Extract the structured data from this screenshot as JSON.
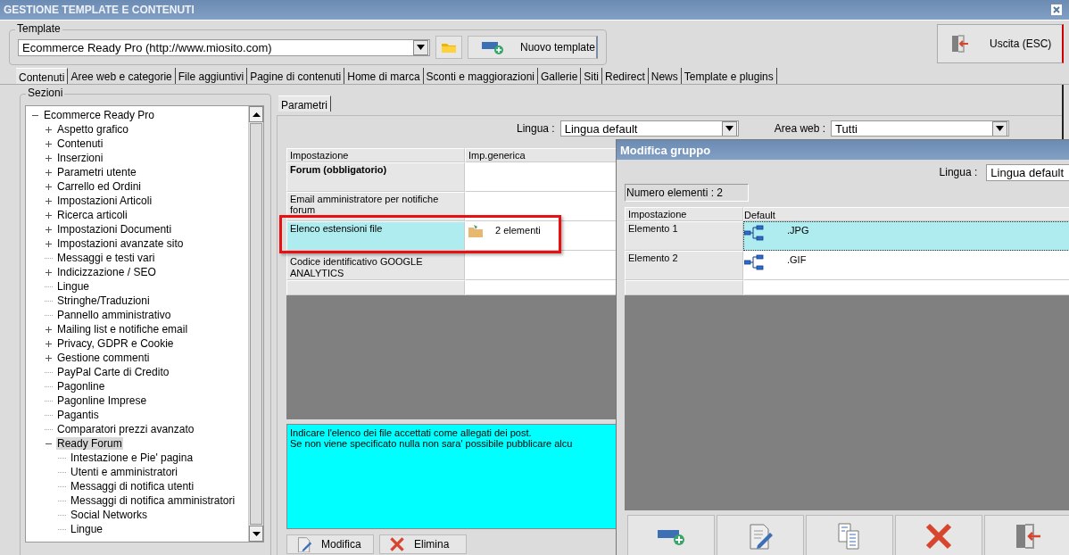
{
  "window": {
    "title": "GESTIONE TEMPLATE E CONTENUTI"
  },
  "template": {
    "legend": "Template",
    "value": "Ecommerce Ready Pro (http://www.miosito.com)",
    "new_button": "Nuovo template",
    "exit_button": "Uscita (ESC)"
  },
  "tabs": [
    {
      "label": "Contenuti",
      "selected": true
    },
    {
      "label": "Aree web e categorie",
      "selected": false
    },
    {
      "label": "File aggiuntivi",
      "selected": false
    },
    {
      "label": "Pagine di contenuti",
      "selected": false
    },
    {
      "label": "Home di marca",
      "selected": false
    },
    {
      "label": "Sconti e maggiorazioni",
      "selected": false
    },
    {
      "label": "Gallerie",
      "selected": false
    },
    {
      "label": "Siti",
      "selected": false
    },
    {
      "label": "Redirect",
      "selected": false
    },
    {
      "label": "News",
      "selected": false
    },
    {
      "label": "Template e plugins",
      "selected": false
    }
  ],
  "sections": {
    "legend": "Sezioni",
    "tree": [
      {
        "label": "Ecommerce Ready Pro",
        "expanded": true,
        "selected": false,
        "children": [
          {
            "label": "Aspetto grafico",
            "expanded": false,
            "selected": false
          },
          {
            "label": "Contenuti",
            "expanded": false,
            "selected": false
          },
          {
            "label": "Inserzioni",
            "expanded": false,
            "selected": false
          },
          {
            "label": "Parametri utente",
            "expanded": false,
            "selected": false
          },
          {
            "label": "Carrello ed Ordini",
            "expanded": false,
            "selected": false
          },
          {
            "label": "Impostazioni Articoli",
            "expanded": false,
            "selected": false
          },
          {
            "label": "Ricerca articoli",
            "expanded": false,
            "selected": false
          },
          {
            "label": "Impostazioni Documenti",
            "expanded": false,
            "selected": false
          },
          {
            "label": "Impostazioni avanzate sito",
            "expanded": false,
            "selected": false
          },
          {
            "label": "Messaggi e testi vari",
            "selected": false
          },
          {
            "label": "Indicizzazione / SEO",
            "expanded": false,
            "selected": false
          },
          {
            "label": "Lingue",
            "selected": false
          },
          {
            "label": "Stringhe/Traduzioni",
            "selected": false
          },
          {
            "label": "Pannello amministrativo",
            "selected": false
          },
          {
            "label": "Mailing list e notifiche email",
            "expanded": false,
            "selected": false
          },
          {
            "label": "Privacy, GDPR e Cookie",
            "expanded": false,
            "selected": false
          },
          {
            "label": "Gestione commenti",
            "expanded": false,
            "selected": false
          },
          {
            "label": "PayPal Carte di Credito",
            "selected": false
          },
          {
            "label": "Pagonline",
            "selected": false
          },
          {
            "label": "Pagonline Imprese",
            "selected": false
          },
          {
            "label": "Pagantis",
            "selected": false
          },
          {
            "label": "Comparatori prezzi avanzato",
            "selected": false
          },
          {
            "label": "Ready Forum",
            "expanded": true,
            "selected": true,
            "children": [
              {
                "label": "Intestazione e Pie' pagina",
                "selected": false
              },
              {
                "label": "Utenti e amministratori",
                "selected": false
              },
              {
                "label": "Messaggi di notifica utenti",
                "selected": false
              },
              {
                "label": "Messaggi di notifica amministratori",
                "selected": false
              },
              {
                "label": "Social Networks",
                "selected": false
              },
              {
                "label": "Lingue",
                "selected": false
              }
            ]
          }
        ]
      }
    ]
  },
  "parameters": {
    "tab": "Parametri",
    "language_label": "Lingua :",
    "language": "Lingua default",
    "area_label": "Area web :",
    "area": "Tutti",
    "columns": [
      "Impostazione",
      "Imp.generica"
    ],
    "rows": [
      {
        "name": "Forum (obbligatorio)",
        "bold": true,
        "selected": false
      },
      {
        "name": "Email amministratore per notifiche forum",
        "bold": false,
        "selected": false
      },
      {
        "name": "Elenco estensioni file",
        "bold": false,
        "selected": true,
        "value": "2 elementi"
      },
      {
        "name": "Codice identificativo GOOGLE ANALYTICS",
        "bold": false,
        "selected": false
      },
      {
        "selected": false
      }
    ],
    "description": [
      "Indicare l'elenco dei file accettati come allegati dei post.",
      "Se non viene specificato nulla non sara' possibile pubblicare alcu"
    ],
    "buttons": [
      {
        "kind": "edit",
        "label": "Modifica"
      },
      {
        "kind": "delete",
        "label": "Elimina"
      }
    ]
  },
  "dialog": {
    "title": "Modifica gruppo",
    "language_label": "Lingua :",
    "language": "Lingua default",
    "count": "Numero elementi : 2",
    "columns": [
      "Impostazione",
      "Default"
    ],
    "rows": [
      {
        "name": "Elemento 1",
        "value": ".JPG",
        "selected": true
      },
      {
        "name": "Elemento 2",
        "value": ".GIF",
        "selected": false
      }
    ],
    "buttons": [
      {
        "kind": "add"
      },
      {
        "kind": "edit"
      },
      {
        "kind": "copy"
      },
      {
        "kind": "delete"
      },
      {
        "kind": "exit"
      }
    ]
  }
}
